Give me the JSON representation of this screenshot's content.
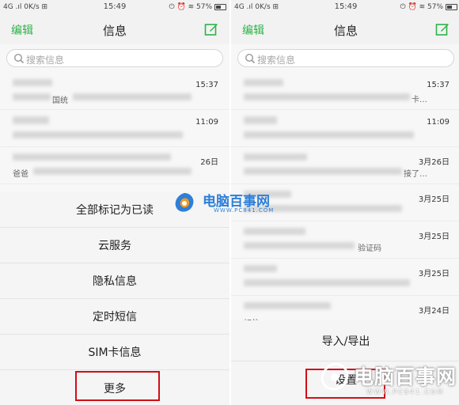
{
  "status_bar": {
    "left": "4G  .ıl  0K/s  ⊞",
    "time": "15:49",
    "right": "⏻  ⏰  ≋  57%",
    "battery_level": 0.57
  },
  "header": {
    "edit_label": "编辑",
    "title": "信息",
    "compose_icon": "compose-icon",
    "accent_color": "#2eb24a"
  },
  "search": {
    "placeholder": "搜索信息"
  },
  "left_panel": {
    "threads": [
      {
        "time": "15:37",
        "snippet": "国统"
      },
      {
        "time": "11:09",
        "snippet": ""
      },
      {
        "time": "26日",
        "snippet": "爸爸"
      }
    ],
    "menu": [
      "全部标记为已读",
      "云服务",
      "隐私信息",
      "定时短信",
      "SIM卡信息",
      "更多"
    ]
  },
  "right_panel": {
    "threads": [
      {
        "time": "15:37",
        "snippet": "卡…"
      },
      {
        "time": "11:09",
        "snippet": ""
      },
      {
        "time": "3月26日",
        "snippet": "接了…"
      },
      {
        "time": "3月25日",
        "snippet": ""
      },
      {
        "time": "3月25日",
        "snippet": "验证码"
      },
      {
        "time": "3月25日",
        "snippet": ""
      },
      {
        "time": "3月24日",
        "snippet": "好的"
      }
    ],
    "menu": [
      "导入/导出",
      "设置"
    ]
  },
  "watermark": {
    "name": "电脑百事网",
    "url": "WWW.PC841.COM",
    "brand_color": "#2d7fd8",
    "highlight_color": "#d10e17"
  }
}
